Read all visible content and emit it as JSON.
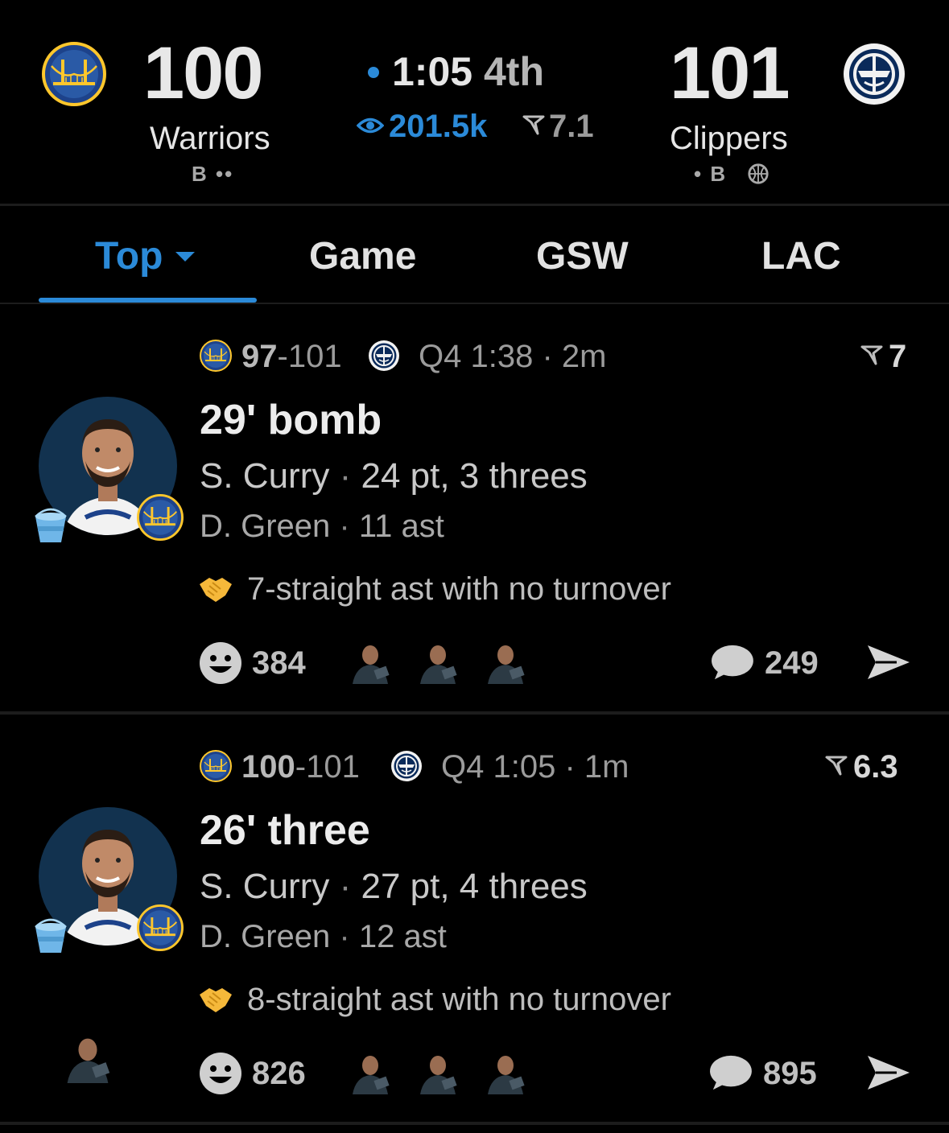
{
  "scoreboard": {
    "home": {
      "name": "Warriors",
      "score": "100",
      "status": "B ••",
      "logo": "warriors-logo"
    },
    "away": {
      "name": "Clippers",
      "score": "101",
      "status": "• B",
      "logo": "clippers-logo"
    },
    "clock_time": "1:05",
    "clock_period": "4th",
    "viewers": "201.5k",
    "rating": "7.1",
    "colors": {
      "accent": "#2b8ad8",
      "background": "#000000"
    }
  },
  "tabs": [
    {
      "label": "Top",
      "active": true
    },
    {
      "label": "Game"
    },
    {
      "label": "GSW"
    },
    {
      "label": "LAC"
    }
  ],
  "plays": [
    {
      "home_score": "97",
      "away_score": "101",
      "time": "Q4 1:38",
      "ago": "2m",
      "rating": "7",
      "headline": "29' bomb",
      "player1": "S. Curry",
      "player1_stat": "24 pt, 3 threes",
      "player2": "D. Green",
      "player2_stat": "11 ast",
      "note": "7-straight ast with no turnover",
      "reactions": "384",
      "comments": "249"
    },
    {
      "home_score": "100",
      "away_score": "101",
      "time": "Q4 1:05",
      "ago": "1m",
      "rating": "6.3",
      "headline": "26' three",
      "player1": "S. Curry",
      "player1_stat": "27 pt, 4 threes",
      "player2": "D. Green",
      "player2_stat": "12 ast",
      "note": "8-straight ast with no turnover",
      "reactions": "826",
      "comments": "895"
    }
  ],
  "separator": "·",
  "score_dash": "-"
}
